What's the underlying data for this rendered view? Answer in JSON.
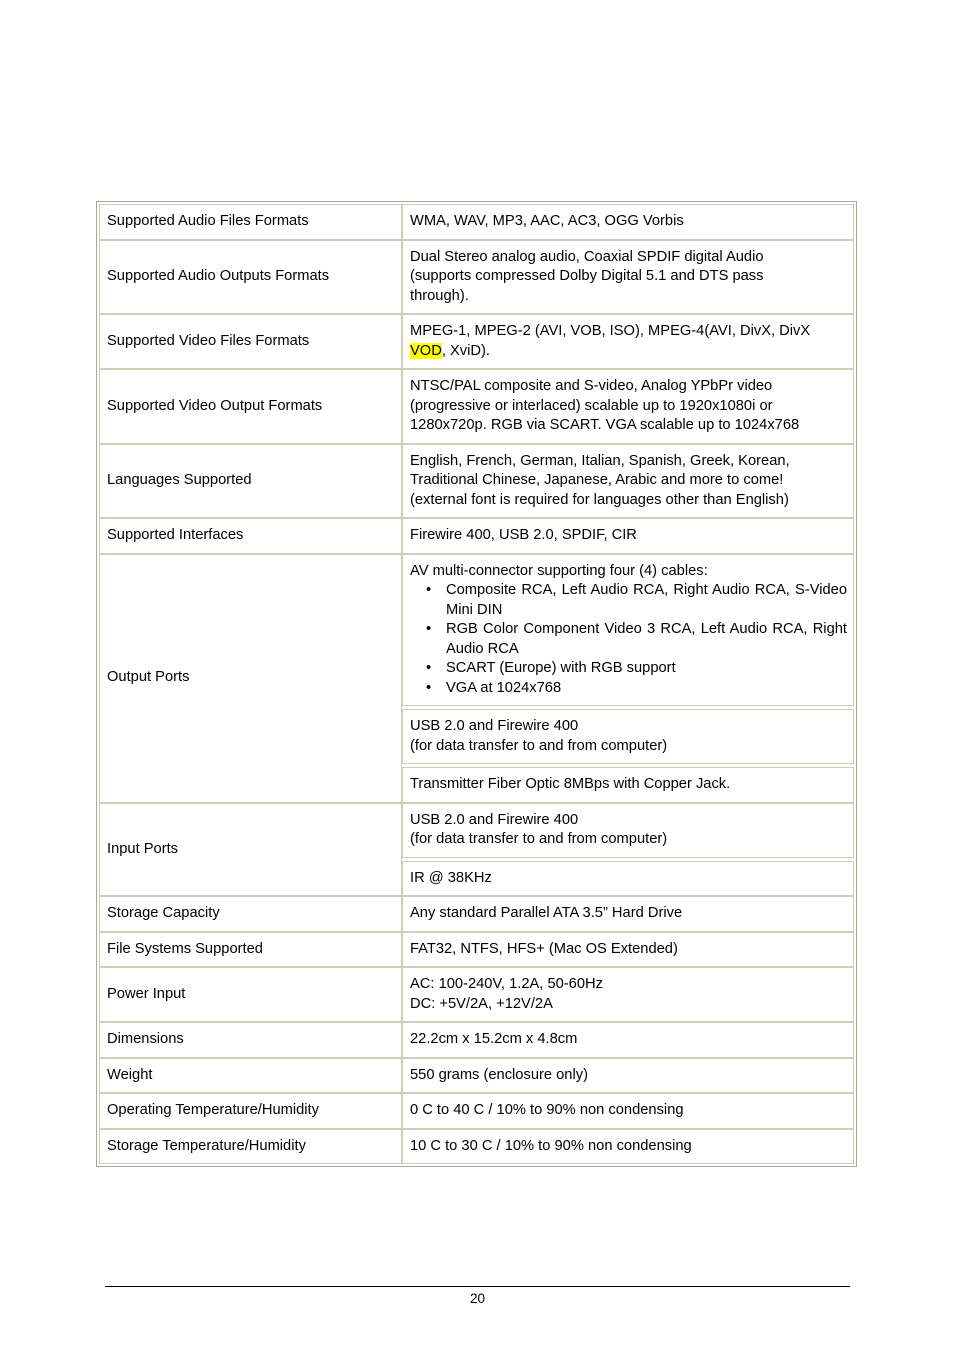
{
  "document": {
    "page_number": "20"
  },
  "spec_table": {
    "rows": [
      {
        "label": "Supported Audio Files Formats",
        "values": [
          {
            "lines": [
              "WMA, WAV, MP3, AAC, AC3, OGG Vorbis"
            ]
          }
        ]
      },
      {
        "label": "Supported Audio Outputs Formats",
        "values": [
          {
            "lines": [
              "Dual Stereo analog audio, Coaxial SPDIF digital Audio",
              "(supports compressed Dolby Digital 5.1 and DTS pass",
              "through)."
            ]
          }
        ]
      },
      {
        "label": "Supported Video Files Formats",
        "values": [
          {
            "lines": [
              "MPEG-1, MPEG-2 (AVI, VOB, ISO), MPEG-4(AVI, DivX, DivX",
              "VOD, XviD)."
            ],
            "highlight": "VOD",
            "highlight_color": "#ffff00"
          }
        ]
      },
      {
        "label": "Supported Video Output Formats",
        "values": [
          {
            "lines": [
              "NTSC/PAL composite and S-video, Analog YPbPr video",
              "(progressive or interlaced) scalable up to 1920x1080i or",
              "1280x720p. RGB via SCART. VGA scalable up to 1024x768"
            ]
          }
        ]
      },
      {
        "label": "Languages Supported",
        "values": [
          {
            "justify": true,
            "lines": [
              "English, French, German, Italian, Spanish, Greek, Korean,",
              "Traditional Chinese, Japanese, Arabic and more to come!",
              "(external font is required for languages other than English)"
            ]
          }
        ]
      },
      {
        "label": "Supported Interfaces",
        "values": [
          {
            "lines": [
              "Firewire 400, USB 2.0, SPDIF, CIR"
            ]
          }
        ]
      },
      {
        "label": "Output Ports",
        "values": [
          {
            "intro": "AV multi-connector supporting four (4) cables:",
            "bullets": [
              "Composite RCA, Left Audio RCA, Right Audio RCA, S-Video Mini DIN",
              "RGB Color Component Video 3 RCA, Left Audio RCA, Right Audio RCA",
              "SCART (Europe) with RGB support",
              "VGA at 1024x768"
            ]
          },
          {
            "lines": [
              "USB 2.0 and Firewire 400",
              "(for data transfer to and from computer)"
            ]
          },
          {
            "lines": [
              "Transmitter Fiber Optic 8MBps with Copper Jack."
            ]
          }
        ]
      },
      {
        "label": "Input Ports",
        "values": [
          {
            "lines": [
              "USB 2.0 and Firewire 400",
              "(for data transfer to and from computer)"
            ]
          },
          {
            "lines": [
              "IR @ 38KHz"
            ]
          }
        ]
      },
      {
        "label": "Storage Capacity",
        "values": [
          {
            "lines": [
              "Any standard Parallel ATA 3.5” Hard Drive"
            ]
          }
        ]
      },
      {
        "label": "File Systems Supported",
        "values": [
          {
            "lines": [
              "FAT32, NTFS, HFS+ (Mac OS Extended)"
            ]
          }
        ]
      },
      {
        "label": "Power Input",
        "values": [
          {
            "lines": [
              "AC: 100-240V, 1.2A, 50-60Hz",
              "DC: +5V/2A, +12V/2A"
            ]
          }
        ]
      },
      {
        "label": "Dimensions",
        "values": [
          {
            "lines": [
              "22.2cm x 15.2cm x 4.8cm"
            ]
          }
        ]
      },
      {
        "label": "Weight",
        "values": [
          {
            "lines": [
              "550 grams (enclosure only)"
            ]
          }
        ]
      },
      {
        "label": "Operating Temperature/Humidity",
        "values": [
          {
            "lines": [
              "0 C to 40 C / 10% to 90% non condensing"
            ]
          }
        ]
      },
      {
        "label": "Storage Temperature/Humidity",
        "values": [
          {
            "lines": [
              "10 C to 30 C / 10% to 90% non condensing"
            ]
          }
        ]
      }
    ]
  },
  "style": {
    "border_color": "#cfcdb9",
    "outer_border_color": "#a9a798",
    "highlight_color": "#ffff00"
  }
}
